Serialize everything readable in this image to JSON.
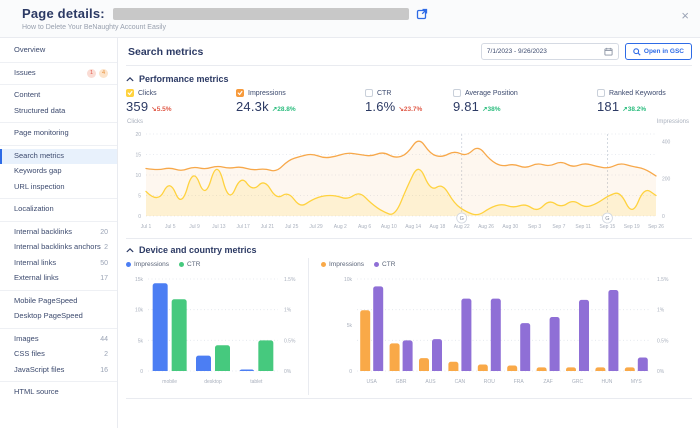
{
  "header": {
    "title": "Page details:",
    "subtitle": "How to Delete Your BeNaughty Account Easily",
    "close_icon": "×"
  },
  "sidebar": {
    "groups": [
      {
        "items": [
          {
            "label": "Overview"
          }
        ]
      },
      {
        "items": [
          {
            "label": "Issues",
            "badges": [
              "1",
              "4"
            ]
          }
        ]
      },
      {
        "items": [
          {
            "label": "Content"
          },
          {
            "label": "Structured data"
          }
        ]
      },
      {
        "items": [
          {
            "label": "Page monitoring"
          }
        ]
      },
      {
        "items": [
          {
            "label": "Search metrics",
            "active": true
          },
          {
            "label": "Keywords gap"
          },
          {
            "label": "URL inspection"
          }
        ]
      },
      {
        "items": [
          {
            "label": "Localization"
          }
        ]
      },
      {
        "items": [
          {
            "label": "Internal backlinks",
            "count": "20"
          },
          {
            "label": "Internal backlinks anchors",
            "count": "2"
          },
          {
            "label": "Internal links",
            "count": "50"
          },
          {
            "label": "External links",
            "count": "17"
          }
        ]
      },
      {
        "items": [
          {
            "label": "Mobile PageSpeed"
          },
          {
            "label": "Desktop PageSpeed"
          }
        ]
      },
      {
        "items": [
          {
            "label": "Images",
            "count": "44"
          },
          {
            "label": "CSS files",
            "count": "2"
          },
          {
            "label": "JavaScript files",
            "count": "16"
          }
        ]
      },
      {
        "items": [
          {
            "label": "HTML source"
          }
        ]
      }
    ]
  },
  "main": {
    "title": "Search metrics",
    "date_range": "7/1/2023 - 9/26/2023",
    "gsc_button": "Open in GSC"
  },
  "performance": {
    "title": "Performance metrics",
    "metrics": [
      {
        "label": "Clicks",
        "value": "359",
        "delta": "5.5%",
        "trend": "down",
        "checked": true,
        "color": "#ffd23e"
      },
      {
        "label": "Impressions",
        "value": "24.3k",
        "delta": "28.8%",
        "trend": "up",
        "checked": true,
        "color": "#f79a3b"
      },
      {
        "label": "CTR",
        "value": "1.6%",
        "delta": "23.7%",
        "trend": "down",
        "checked": false
      },
      {
        "label": "Average Position",
        "value": "9.81",
        "delta": "38%",
        "trend": "up",
        "checked": false
      },
      {
        "label": "Ranked Keywords",
        "value": "181",
        "delta": "38.2%",
        "trend": "up",
        "checked": false
      }
    ]
  },
  "device_section": {
    "title": "Device and country metrics"
  },
  "chart_data": [
    {
      "id": "performance-line",
      "type": "line",
      "y_left": {
        "label": "Clicks",
        "ticks": [
          20,
          15,
          10,
          5,
          0
        ],
        "max": 20
      },
      "y_right": {
        "label": "Impressions",
        "ticks": [
          400,
          200,
          0
        ],
        "max": 440
      },
      "x_labels": [
        "Jul 1",
        "Jul 5",
        "Jul 9",
        "Jul 13",
        "Jul 17",
        "Jul 21",
        "Jul 25",
        "Jul 29",
        "Aug 2",
        "Aug 6",
        "Aug 10",
        "Aug 14",
        "Aug 18",
        "Aug 22",
        "Aug 26",
        "Aug 30",
        "Sep 3",
        "Sep 7",
        "Sep 11",
        "Sep 15",
        "Sep 19",
        "Sep 26"
      ],
      "annotations": [
        {
          "label": "G",
          "at_label": "Aug 22"
        },
        {
          "label": "G",
          "at_label": "Sep 15"
        }
      ],
      "series": [
        {
          "name": "Impressions",
          "axis": "right",
          "color": "#f7a84a",
          "fill_opacity": 0.09,
          "values": [
            255,
            245,
            260,
            240,
            265,
            250,
            270,
            255,
            265,
            245,
            255,
            235,
            300,
            320,
            335,
            310,
            320,
            340,
            330,
            320,
            345,
            310,
            330,
            425,
            330,
            315,
            350,
            320,
            380,
            300,
            265,
            280,
            255,
            285,
            265,
            295,
            260,
            285,
            265,
            255,
            285,
            265,
            255,
            215
          ]
        },
        {
          "name": "Clicks",
          "axis": "left",
          "color": "#ffd23e",
          "fill_opacity": 0.16,
          "values": [
            6,
            3,
            9,
            2,
            12,
            4,
            14,
            3,
            10,
            6,
            9,
            4,
            6,
            2,
            4,
            5,
            5,
            4,
            6,
            3,
            1,
            0,
            7,
            13,
            6,
            8,
            3,
            1,
            0,
            2,
            3,
            2,
            3,
            1,
            4,
            2,
            4,
            2,
            3,
            5,
            6,
            0,
            7,
            5
          ]
        }
      ]
    },
    {
      "id": "device-bars",
      "type": "bar",
      "categories": [
        "mobile",
        "desktop",
        "tablet"
      ],
      "y_left": {
        "ticks": [
          "15k",
          "10k",
          "5k",
          "0"
        ],
        "max": 15000
      },
      "y_right": {
        "ticks": [
          "1.5%",
          "1%",
          "0.5%",
          "0%"
        ],
        "max": 1.5
      },
      "series": [
        {
          "name": "Impressions",
          "axis": "left",
          "color": "#4c7ef3",
          "values": [
            14300,
            2500,
            250
          ]
        },
        {
          "name": "CTR",
          "axis": "right",
          "color": "#46c97e",
          "values": [
            1.17,
            0.42,
            0.5
          ]
        }
      ]
    },
    {
      "id": "country-bars",
      "type": "bar",
      "categories": [
        "USA",
        "GBR",
        "AUS",
        "CAN",
        "ROU",
        "FRA",
        "ZAF",
        "GRC",
        "HUN",
        "MYS"
      ],
      "y_left": {
        "ticks": [
          "10k",
          "5k",
          "0"
        ],
        "max": 10000
      },
      "y_right": {
        "ticks": [
          "1.5%",
          "1%",
          "0.5%",
          "0%"
        ],
        "max": 1.5
      },
      "series": [
        {
          "name": "Impressions",
          "axis": "left",
          "color": "#f9a948",
          "values": [
            6600,
            3000,
            1400,
            1000,
            700,
            600,
            400,
            400,
            400,
            400
          ]
        },
        {
          "name": "CTR",
          "axis": "right",
          "color": "#8f6fd6",
          "values": [
            1.38,
            0.5,
            0.52,
            1.18,
            1.18,
            0.78,
            0.88,
            1.16,
            1.32,
            0.22
          ]
        }
      ]
    }
  ]
}
